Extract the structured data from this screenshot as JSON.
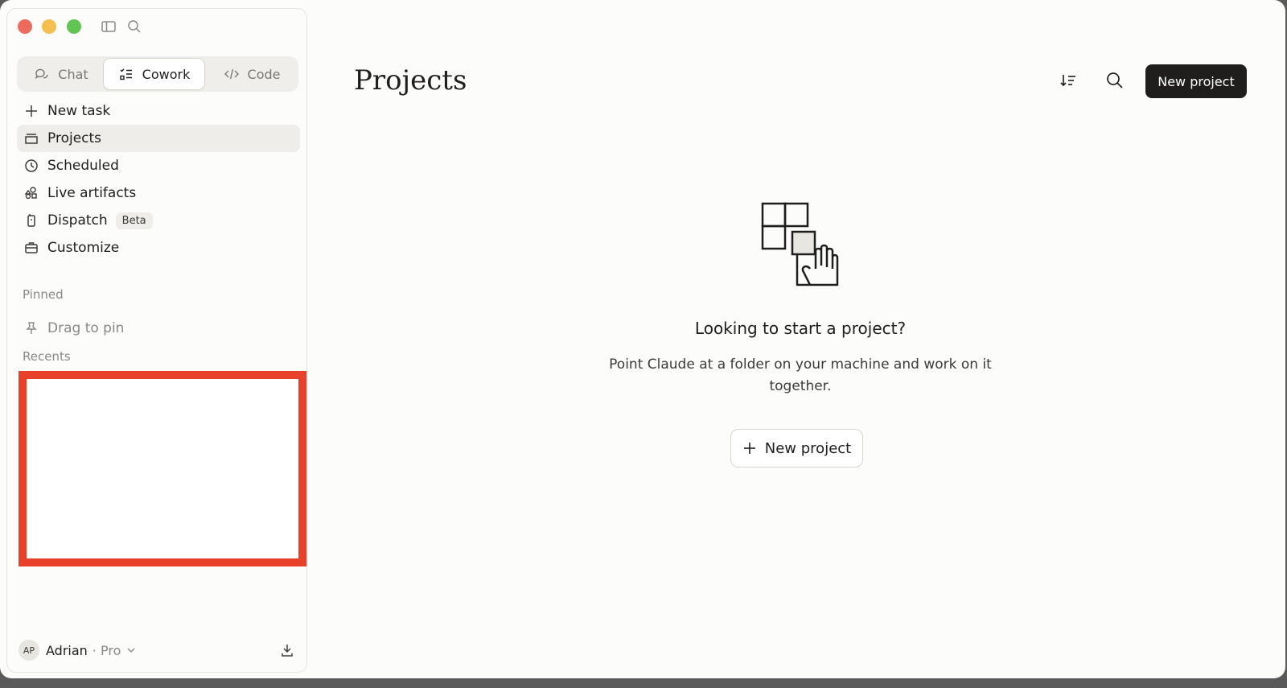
{
  "sidebar": {
    "tabs": [
      {
        "label": "Chat",
        "icon": "chat-icon"
      },
      {
        "label": "Cowork",
        "icon": "cowork-icon"
      },
      {
        "label": "Code",
        "icon": "code-icon"
      }
    ],
    "nav": [
      {
        "label": "New task",
        "icon": "plus-icon"
      },
      {
        "label": "Projects",
        "icon": "projects-icon"
      },
      {
        "label": "Scheduled",
        "icon": "clock-icon"
      },
      {
        "label": "Live artifacts",
        "icon": "shapes-icon"
      },
      {
        "label": "Dispatch",
        "icon": "phone-icon",
        "badge": "Beta"
      },
      {
        "label": "Customize",
        "icon": "briefcase-icon"
      }
    ],
    "pinned_label": "Pinned",
    "pin_hint": "Drag to pin",
    "recents_label": "Recents",
    "user": {
      "initials": "AP",
      "name": "Adrian",
      "plan": "· Pro"
    }
  },
  "main": {
    "title": "Projects",
    "new_project_label": "New project",
    "empty": {
      "heading": "Looking to start a project?",
      "body": "Point Claude at a folder on your machine and work on it together.",
      "button_label": "New project"
    }
  },
  "colors": {
    "accent_dark": "#1f1e1d",
    "redaction": "#e8412a",
    "background": "#fcfcfb"
  }
}
